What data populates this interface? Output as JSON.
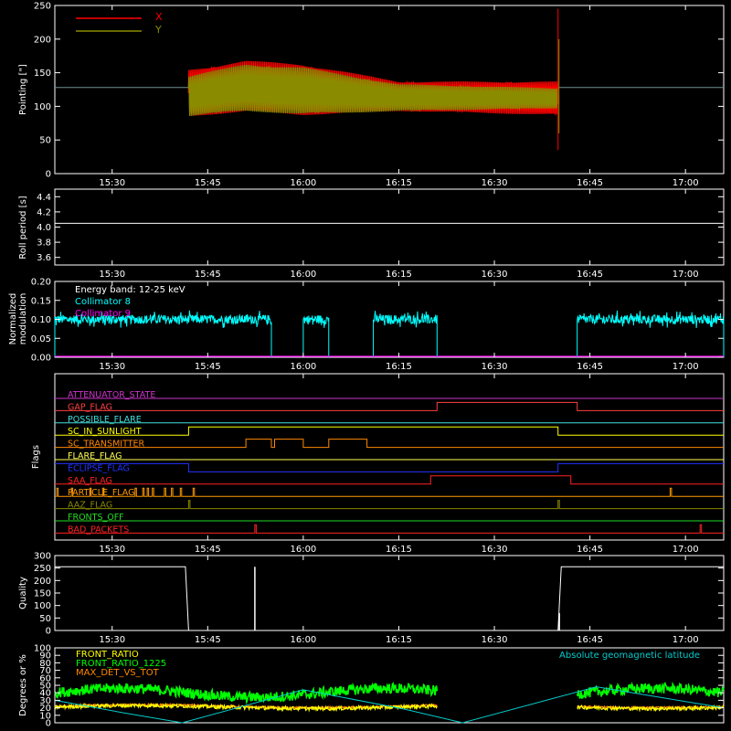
{
  "time_labels": [
    "15:30",
    "15:45",
    "16:00",
    "16:15",
    "16:30",
    "16:45",
    "17:00"
  ],
  "chart_data": [
    {
      "type": "line",
      "panel": "pointing",
      "ylabel": "Pointing [\"]",
      "ylim": [
        0,
        250
      ],
      "yticks": [
        "0",
        "50",
        "100",
        "150",
        "200",
        "250"
      ],
      "xlim": [
        "15:21",
        "17:06"
      ],
      "series": [
        {
          "name": "X",
          "color": "#ff0000",
          "segments": [
            {
              "start": "15:42",
              "end": "16:40",
              "center": [
                [
                  15.7,
                  120
                ],
                [
                  15.85,
                  130
                ],
                [
                  16.0,
                  125
                ],
                [
                  16.25,
                  115
                ],
                [
                  16.67,
                  112
                ]
              ],
              "halfwidth": [
                [
                  15.7,
                  35
                ],
                [
                  15.85,
                  38
                ],
                [
                  16.0,
                  38
                ],
                [
                  16.25,
                  22
                ],
                [
                  16.67,
                  25
                ]
              ]
            }
          ]
        },
        {
          "name": "Y",
          "color": "#8b8b00",
          "segments": [
            {
              "start": "15:42",
              "end": "16:40",
              "center": [
                [
                  15.7,
                  115
                ],
                [
                  15.85,
                  128
                ],
                [
                  16.0,
                  123
                ],
                [
                  16.25,
                  113
                ],
                [
                  16.67,
                  112
                ]
              ],
              "halfwidth": [
                [
                  15.7,
                  30
                ],
                [
                  15.85,
                  35
                ],
                [
                  16.0,
                  35
                ],
                [
                  16.25,
                  20
                ],
                [
                  16.67,
                  15
                ]
              ]
            }
          ]
        }
      ],
      "baseline": 128
    },
    {
      "type": "line",
      "panel": "roll",
      "ylabel": "Roll period [s]",
      "ylim": [
        3.5,
        4.5
      ],
      "yticks": [
        "3.6",
        "3.8",
        "4.0",
        "4.2",
        "4.4"
      ],
      "series": [
        {
          "name": "",
          "color": "#ffffff",
          "value": 4.05
        }
      ]
    },
    {
      "type": "line",
      "panel": "modulation",
      "ylabel_lines": [
        "Normalized",
        "modulation"
      ],
      "ylim": [
        0,
        0.2
      ],
      "yticks": [
        "0.00",
        "0.05",
        "0.10",
        "0.15",
        "0.20"
      ],
      "annotations": [
        "Energy band: 12-25 keV",
        "Collimator 8",
        "Collimator 9"
      ],
      "series": [
        {
          "name": "Collimator 8",
          "color": "#00ffff",
          "level": 0.1,
          "noise": 0.012,
          "intervals": [
            [
              "15:21",
              "15:55"
            ],
            [
              "16:00",
              "16:04"
            ],
            [
              "16:11",
              "16:21"
            ],
            [
              "16:43",
              "17:06"
            ]
          ]
        },
        {
          "name": "Collimator 9",
          "color": "#ff00ff",
          "value": 0.0
        }
      ]
    },
    {
      "type": "line",
      "panel": "flags",
      "ylabel": "Flags",
      "series": [
        {
          "name": "ATTENUATOR_STATE",
          "color": "#cc33cc",
          "transitions": []
        },
        {
          "name": "GAP_FLAG",
          "color": "#ff4040",
          "transitions": [
            [
              "16:21",
              1
            ],
            [
              "16:43",
              0
            ]
          ]
        },
        {
          "name": "POSSIBLE_FLARE",
          "color": "#44dddd",
          "transitions": []
        },
        {
          "name": "SC_IN_SUNLIGHT",
          "color": "#ffff00",
          "transitions": [
            [
              "15:42",
              1
            ],
            [
              "16:40",
              0
            ]
          ]
        },
        {
          "name": "SC_TRANSMITTER",
          "color": "#ff8800",
          "transitions": [
            [
              "15:51",
              1
            ],
            [
              "15:55",
              0
            ],
            [
              "15:55.5",
              1
            ],
            [
              "16:00",
              0
            ],
            [
              "16:04",
              1
            ],
            [
              "16:10",
              0
            ]
          ]
        },
        {
          "name": "FLARE_FLAG",
          "color": "#ffff55",
          "transitions": []
        },
        {
          "name": "ECLIPSE_FLAG",
          "color": "#2233ff",
          "start": 1,
          "transitions": [
            [
              "15:42",
              0
            ],
            [
              "16:40",
              1
            ]
          ]
        },
        {
          "name": "SAA_FLAG",
          "color": "#ff2222",
          "transitions": [
            [
              "16:20",
              1
            ],
            [
              "16:42",
              0
            ]
          ]
        },
        {
          "name": "PARTICLE_FLAG",
          "color": "#ff9900",
          "pulses": [
            "15:21.3",
            "15:23.6",
            "15:26.5",
            "15:28.5",
            "15:33.6",
            "15:34.8",
            "15:35.5",
            "15:36.3",
            "15:38.2",
            "15:39.3",
            "15:40.7",
            "15:42.7",
            "16:57.6"
          ]
        },
        {
          "name": "AAZ_FLAG",
          "color": "#888800",
          "pulses": [
            "15:42.0",
            "16:40.0"
          ]
        },
        {
          "name": "FRONTS_OFF",
          "color": "#22dd22",
          "transitions": []
        },
        {
          "name": "BAD_PACKETS",
          "color": "#ff2222",
          "pulses": [
            "15:52.4",
            "17:02.3"
          ]
        }
      ]
    },
    {
      "type": "line",
      "panel": "quality",
      "ylabel": "Quality",
      "ylim": [
        0,
        300
      ],
      "yticks": [
        "0",
        "50",
        "100",
        "150",
        "200",
        "250",
        "300"
      ],
      "series": [
        {
          "name": "",
          "color": "#ffffff",
          "segments": [
            [
              [
                "15:21",
                255
              ],
              [
                "15:41.5",
                255
              ],
              [
                "15:42",
                0
              ],
              [
                "16:40",
                0
              ],
              [
                "16:40.5",
                255
              ],
              [
                "17:06",
                255
              ]
            ]
          ],
          "spikes": [
            [
              "15:52.4",
              255
            ],
            [
              "16:40.2",
              70
            ]
          ]
        }
      ]
    },
    {
      "type": "line",
      "panel": "latitude",
      "ylabel": "Degrees or %",
      "ylim": [
        0,
        100
      ],
      "yticks": [
        "0",
        "10",
        "20",
        "30",
        "40",
        "50",
        "60",
        "70",
        "80",
        "90",
        "100"
      ],
      "legend": [
        "FRONT_RATIO",
        "FRONT_RATIO_1225",
        "MAX_DET_VS_TOT"
      ],
      "right_label": "Absolute geomagnetic latitude",
      "series": [
        {
          "name": "FRONT_RATIO",
          "color": "#ffff00",
          "level": 21,
          "noise": 2.5,
          "intervals": [
            [
              "15:21",
              "16:21"
            ],
            [
              "16:43",
              "17:06"
            ]
          ]
        },
        {
          "name": "FRONT_RATIO_1225",
          "color": "#00ff00",
          "level": 40,
          "noise": 7,
          "intervals": [
            [
              "15:21",
              "16:21"
            ],
            [
              "16:43",
              "17:06"
            ]
          ]
        },
        {
          "name": "MAX_DET_VS_TOT",
          "color": "#ff8800",
          "level": 22,
          "noise": 1.5,
          "intervals": [
            [
              "15:21",
              "16:21"
            ],
            [
              "16:43",
              "17:06"
            ]
          ]
        },
        {
          "name": "Absolute geomagnetic latitude",
          "color": "#00cccc",
          "points": [
            [
              "15:21",
              30
            ],
            [
              "15:32",
              13
            ],
            [
              "15:41",
              0
            ],
            [
              "16:00",
              44
            ],
            [
              "16:16",
              18
            ],
            [
              "16:25",
              0
            ],
            [
              "16:46",
              48
            ],
            [
              "17:06",
              20
            ]
          ]
        }
      ]
    }
  ]
}
